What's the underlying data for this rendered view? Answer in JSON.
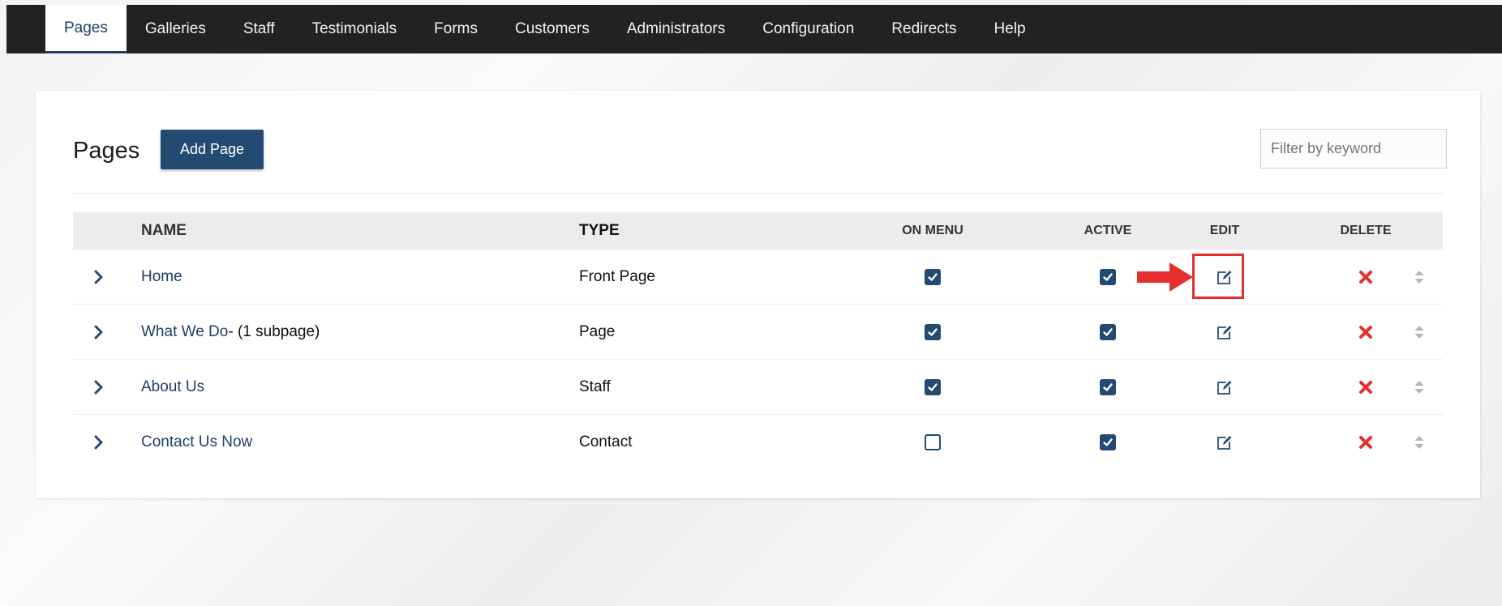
{
  "nav": {
    "items": [
      "Pages",
      "Galleries",
      "Staff",
      "Testimonials",
      "Forms",
      "Customers",
      "Administrators",
      "Configuration",
      "Redirects",
      "Help"
    ],
    "active": "Pages"
  },
  "header": {
    "title": "Pages",
    "add_label": "Add Page",
    "filter_placeholder": "Filter by keyword"
  },
  "table": {
    "columns": {
      "name": "NAME",
      "type": "TYPE",
      "on_menu": "ON MENU",
      "active": "ACTIVE",
      "edit": "EDIT",
      "delete": "DELETE"
    },
    "rows": [
      {
        "name": "Home",
        "extra": "",
        "type": "Front Page",
        "on_menu": true,
        "active": true
      },
      {
        "name": "What We Do",
        "extra": " - (1 subpage)",
        "type": "Page",
        "on_menu": true,
        "active": true
      },
      {
        "name": "About Us",
        "extra": "",
        "type": "Staff",
        "on_menu": true,
        "active": true
      },
      {
        "name": "Contact Us Now",
        "extra": "",
        "type": "Contact",
        "on_menu": false,
        "active": true
      }
    ]
  },
  "annotation": {
    "highlight_row": 0,
    "color": "#e62e2e"
  },
  "colors": {
    "nav_bg": "#222222",
    "accent": "#234a73",
    "delete": "#e62e2e"
  },
  "icons": {
    "expand": "chevron-right-icon",
    "edit": "edit-icon",
    "delete": "x-icon",
    "sort": "sort-handle-icon"
  }
}
